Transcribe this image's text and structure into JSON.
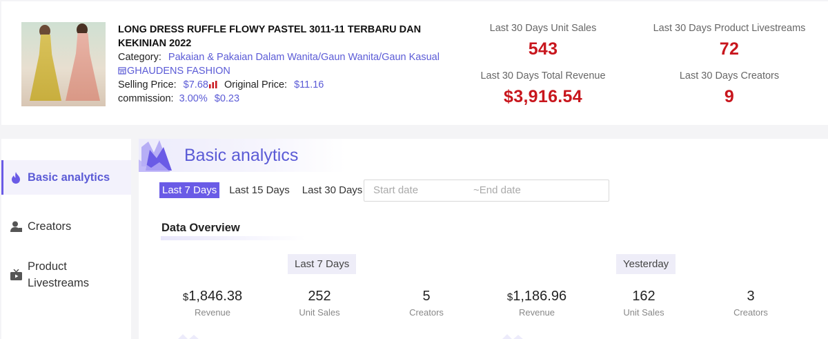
{
  "product": {
    "title": "LONG DRESS RUFFLE FLOWY PASTEL 3011-11 TERBARU DAN KEKINIAN 2022",
    "category_label": "Category:",
    "category_value": "Pakaian & Pakaian Dalam Wanita/Gaun Wanita/Gaun Kasual",
    "shop_name": "GHAUDENS FASHION",
    "selling_price_label": "Selling Price:",
    "selling_price": "$7.68",
    "original_price_label": "Original Price:",
    "original_price": "$11.16",
    "commission_label": "commission:",
    "commission_rate": "3.00%",
    "commission_amount": "$0.23"
  },
  "stats": {
    "unit_sales": {
      "label": "Last 30 Days Unit Sales",
      "value": "543"
    },
    "livestreams": {
      "label": "Last 30 Days Product Livestreams",
      "value": "72"
    },
    "revenue": {
      "label": "Last 30 Days Total Revenue",
      "value": "$3,916.54"
    },
    "creators": {
      "label": "Last 30 Days Creators",
      "value": "9"
    }
  },
  "sidebar": {
    "items": [
      {
        "label": "Basic analytics",
        "icon": "flame-icon",
        "active": true
      },
      {
        "label": "Creators",
        "icon": "user-icon"
      },
      {
        "label": "Product Livestreams",
        "icon": "tv-icon"
      }
    ]
  },
  "main": {
    "section_title": "Basic analytics",
    "tabs": [
      "Last 7 Days",
      "Last 15 Days",
      "Last 30 Days"
    ],
    "date_start_placeholder": "Start date",
    "date_end_placeholder": "~End date",
    "overview_title": "Data Overview",
    "periods": [
      {
        "tag": "Last 7 Days",
        "metrics": [
          {
            "currency": "$",
            "value": "1,846.38",
            "caption": "Revenue"
          },
          {
            "value": "252",
            "caption": "Unit Sales"
          },
          {
            "value": "5",
            "caption": "Creators"
          }
        ]
      },
      {
        "tag": "Yesterday",
        "metrics": [
          {
            "currency": "$",
            "value": "1,186.96",
            "caption": "Revenue"
          },
          {
            "value": "162",
            "caption": "Unit Sales"
          },
          {
            "value": "3",
            "caption": "Creators"
          }
        ]
      }
    ]
  },
  "colors": {
    "accent": "#5b5bd6",
    "accent_dark": "#6a5be6",
    "stat_red": "#c8161d"
  }
}
